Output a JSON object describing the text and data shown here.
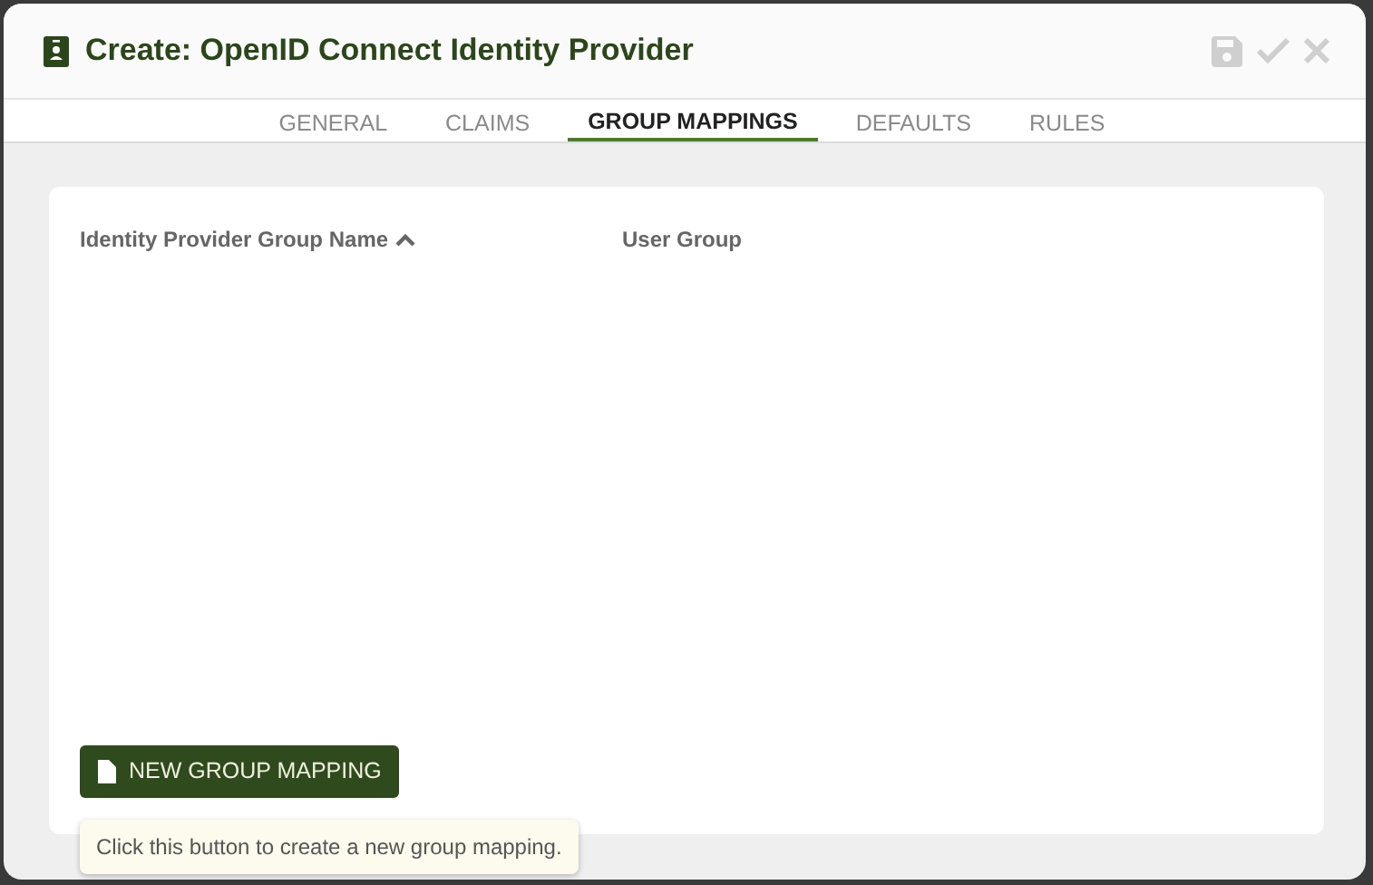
{
  "dialog": {
    "title": "Create: OpenID Connect Identity Provider"
  },
  "tabs": [
    {
      "label": "GENERAL",
      "selected": false
    },
    {
      "label": "CLAIMS",
      "selected": false
    },
    {
      "label": "GROUP MAPPINGS",
      "selected": true
    },
    {
      "label": "DEFAULTS",
      "selected": false
    },
    {
      "label": "RULES",
      "selected": false
    }
  ],
  "table": {
    "columns": [
      {
        "label": "Identity Provider Group Name",
        "sorted_ascending": true
      },
      {
        "label": "User Group",
        "sorted_ascending": false
      }
    ]
  },
  "button": {
    "label": "NEW GROUP MAPPING"
  },
  "tooltip": {
    "text": "Click this button to create a new group mapping."
  }
}
